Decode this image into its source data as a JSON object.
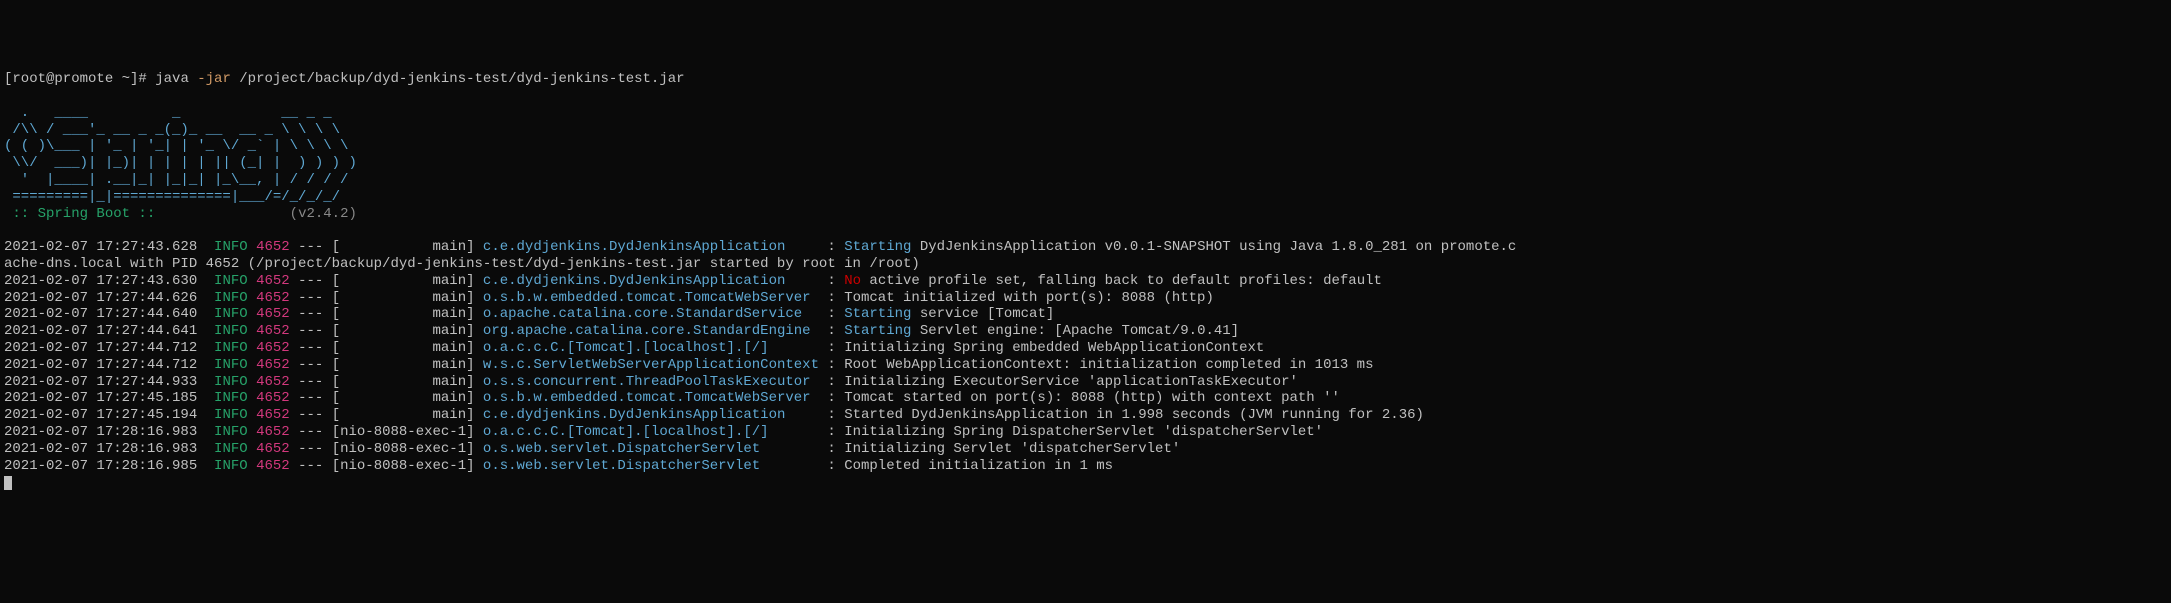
{
  "prompt": {
    "user_host": "[root@promote ~]# ",
    "cmd_java": "java ",
    "cmd_flag": "-jar",
    "cmd_path": " /project/backup/dyd-jenkins-test/dyd-jenkins-test.jar"
  },
  "ascii": {
    "l1": "  .   ____          _            __ _ _",
    "l2": " /\\\\ / ___'_ __ _ _(_)_ __  __ _ \\ \\ \\ \\",
    "l3": "( ( )\\___ | '_ | '_| | '_ \\/ _` | \\ \\ \\ \\",
    "l4": " \\\\/  ___)| |_)| | | | | || (_| |  ) ) ) )",
    "l5": "  '  |____| .__|_| |_|_| |_\\__, | / / / /",
    "l6": " =========|_|==============|___/=/_/_/_/"
  },
  "spring_boot_line": {
    "label": " :: Spring Boot :: ",
    "spacer": "               ",
    "version": "(v2.4.2)"
  },
  "log": [
    {
      "ts": "2021-02-07 17:27:43.628",
      "lvl": "INFO",
      "pid": "4652",
      "thr": "[           main]",
      "logger": "c.e.dydjenkins.DydJenkinsApplication    ",
      "hw": "Starting",
      "msg": " DydJenkinsApplication v0.0.1-SNAPSHOT using Java 1.8.0_281 on promote.c",
      "hlclass": "msg-start-blue"
    },
    {
      "continuation": true,
      "text": "ache-dns.local with PID 4652 (/project/backup/dyd-jenkins-test/dyd-jenkins-test.jar started by root in /root)"
    },
    {
      "ts": "2021-02-07 17:27:43.630",
      "lvl": "INFO",
      "pid": "4652",
      "thr": "[           main]",
      "logger": "c.e.dydjenkins.DydJenkinsApplication    ",
      "hw": "No",
      "msg": " active profile set, falling back to default profiles: default",
      "hlclass": "msg-start-red"
    },
    {
      "ts": "2021-02-07 17:27:44.626",
      "lvl": "INFO",
      "pid": "4652",
      "thr": "[           main]",
      "logger": "o.s.b.w.embedded.tomcat.TomcatWebServer ",
      "hw": "",
      "msg": "Tomcat initialized with port(s): 8088 (http)",
      "hlclass": ""
    },
    {
      "ts": "2021-02-07 17:27:44.640",
      "lvl": "INFO",
      "pid": "4652",
      "thr": "[           main]",
      "logger": "o.apache.catalina.core.StandardService  ",
      "hw": "Starting",
      "msg": " service [Tomcat]",
      "hlclass": "msg-start-blue"
    },
    {
      "ts": "2021-02-07 17:27:44.641",
      "lvl": "INFO",
      "pid": "4652",
      "thr": "[           main]",
      "logger": "org.apache.catalina.core.StandardEngine ",
      "hw": "Starting",
      "msg": " Servlet engine: [Apache Tomcat/9.0.41]",
      "hlclass": "msg-start-blue"
    },
    {
      "ts": "2021-02-07 17:27:44.712",
      "lvl": "INFO",
      "pid": "4652",
      "thr": "[           main]",
      "logger": "o.a.c.c.C.[Tomcat].[localhost].[/]      ",
      "hw": "",
      "msg": "Initializing Spring embedded WebApplicationContext",
      "hlclass": ""
    },
    {
      "ts": "2021-02-07 17:27:44.712",
      "lvl": "INFO",
      "pid": "4652",
      "thr": "[           main]",
      "logger": "w.s.c.ServletWebServerApplicationContext",
      "hw": "",
      "msg": "Root WebApplicationContext: initialization completed in 1013 ms",
      "hlclass": ""
    },
    {
      "ts": "2021-02-07 17:27:44.933",
      "lvl": "INFO",
      "pid": "4652",
      "thr": "[           main]",
      "logger": "o.s.s.concurrent.ThreadPoolTaskExecutor ",
      "hw": "",
      "msg": "Initializing ExecutorService 'applicationTaskExecutor'",
      "hlclass": ""
    },
    {
      "ts": "2021-02-07 17:27:45.185",
      "lvl": "INFO",
      "pid": "4652",
      "thr": "[           main]",
      "logger": "o.s.b.w.embedded.tomcat.TomcatWebServer ",
      "hw": "",
      "msg": "Tomcat started on port(s): 8088 (http) with context path ''",
      "hlclass": ""
    },
    {
      "ts": "2021-02-07 17:27:45.194",
      "lvl": "INFO",
      "pid": "4652",
      "thr": "[           main]",
      "logger": "c.e.dydjenkins.DydJenkinsApplication    ",
      "hw": "",
      "msg": "Started DydJenkinsApplication in 1.998 seconds (JVM running for 2.36)",
      "hlclass": ""
    },
    {
      "ts": "2021-02-07 17:28:16.983",
      "lvl": "INFO",
      "pid": "4652",
      "thr": "[nio-8088-exec-1]",
      "logger": "o.a.c.c.C.[Tomcat].[localhost].[/]      ",
      "hw": "",
      "msg": "Initializing Spring DispatcherServlet 'dispatcherServlet'",
      "hlclass": ""
    },
    {
      "ts": "2021-02-07 17:28:16.983",
      "lvl": "INFO",
      "pid": "4652",
      "thr": "[nio-8088-exec-1]",
      "logger": "o.s.web.servlet.DispatcherServlet       ",
      "hw": "",
      "msg": "Initializing Servlet 'dispatcherServlet'",
      "hlclass": ""
    },
    {
      "ts": "2021-02-07 17:28:16.985",
      "lvl": "INFO",
      "pid": "4652",
      "thr": "[nio-8088-exec-1]",
      "logger": "o.s.web.servlet.DispatcherServlet       ",
      "hw": "",
      "msg": "Completed initialization in 1 ms",
      "hlclass": ""
    }
  ],
  "dashes_sep": " --- "
}
